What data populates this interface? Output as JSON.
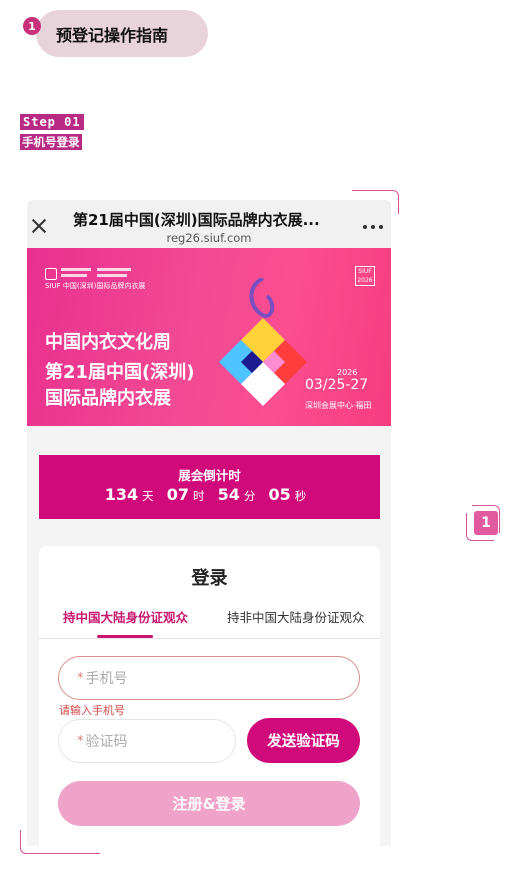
{
  "guide": {
    "number": "1",
    "title": "预登记操作指南"
  },
  "step": {
    "tag": "Step 01",
    "subtitle": "手机号登录"
  },
  "badge": "1",
  "browser": {
    "title": "第21届中国(深圳)国际品牌内衣展...",
    "url": "reg26.siuf.com"
  },
  "banner": {
    "logo_text": "SIUF 中国(深圳)国际品牌内衣展",
    "year_badge": "SIUF 2026",
    "line1": "中国内衣文化周",
    "line2": "第21届中国(深圳)",
    "line3": "国际品牌内衣展",
    "date_year": "2026",
    "date": "03/25-27",
    "venue": "深圳会展中心·福田"
  },
  "countdown": {
    "label": "展会倒计时",
    "days": "134",
    "days_unit": "天",
    "hours": "07",
    "hours_unit": "时",
    "minutes": "54",
    "minutes_unit": "分",
    "seconds": "05",
    "seconds_unit": "秒"
  },
  "login": {
    "title": "登录",
    "tab_mainland": "持中国大陆身份证观众",
    "tab_non_mainland": "持非中国大陆身份证观众",
    "phone_placeholder": "手机号",
    "phone_error": "请输入手机号",
    "code_placeholder": "验证码",
    "required_mark": "*",
    "send_code_button": "发送验证码",
    "register_button": "注册&登录"
  },
  "colors": {
    "brand": "#d10a7c",
    "accent_pink": "#e15aa0",
    "button_disabled": "#f0a3c9"
  }
}
